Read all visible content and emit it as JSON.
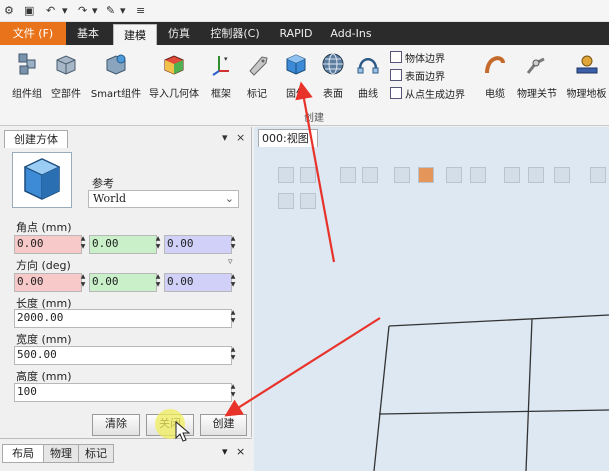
{
  "quick_access": {
    "icons": [
      "gear-icon",
      "save-icon",
      "undo-icon",
      "redo-icon",
      "brush-icon",
      "customize-icon"
    ]
  },
  "tabs": {
    "file": "文件 (F)",
    "basic": "基本",
    "modeling": "建模",
    "simulation": "仿真",
    "controller": "控制器(C)",
    "rapid": "RAPID",
    "addins": "Add-Ins"
  },
  "ribbon": {
    "component_group": "组件组",
    "empty_part": "空部件",
    "smart_component": "Smart组件",
    "import_geometry": "导入几何体",
    "frame": "框架",
    "tag": "标记",
    "solid": "固体",
    "surface": "表面",
    "curve": "曲线",
    "body_border": "物体边界",
    "surface_border": "表面边界",
    "border_from_point": "从点生成边界",
    "create_group_label": "创建",
    "cable": "电缆",
    "physics_joint": "物理关节",
    "physics_base": "物理地板"
  },
  "panel": {
    "title": "创建方体",
    "close_marker": "×",
    "reference_label": "参考",
    "reference_value": "World",
    "corner_label": "角点 (mm)",
    "corner_x": "0.00",
    "corner_y": "0.00",
    "corner_z": "0.00",
    "direction_label": "方向 (deg)",
    "dir_x": "0.00",
    "dir_y": "0.00",
    "dir_z": "0.00",
    "length_label": "长度 (mm)",
    "length_value": "2000.00",
    "width_label": "宽度 (mm)",
    "width_value": "500.00",
    "height_label": "高度 (mm)",
    "height_value": "100",
    "clear_button": "清除",
    "close_button": "关闭",
    "create_button": "创建"
  },
  "bottom_tabs": [
    "布局",
    "物理",
    "标记"
  ],
  "viewport": {
    "tab_label": "000:视图"
  },
  "colors": {
    "file_tab": "#e8731a",
    "x_field": "#f8c9c9",
    "y_field": "#c9f0c9",
    "z_field": "#d0d0f8",
    "annotation_arrow": "#e8332a",
    "viewport_bg": "#dde8f3"
  }
}
